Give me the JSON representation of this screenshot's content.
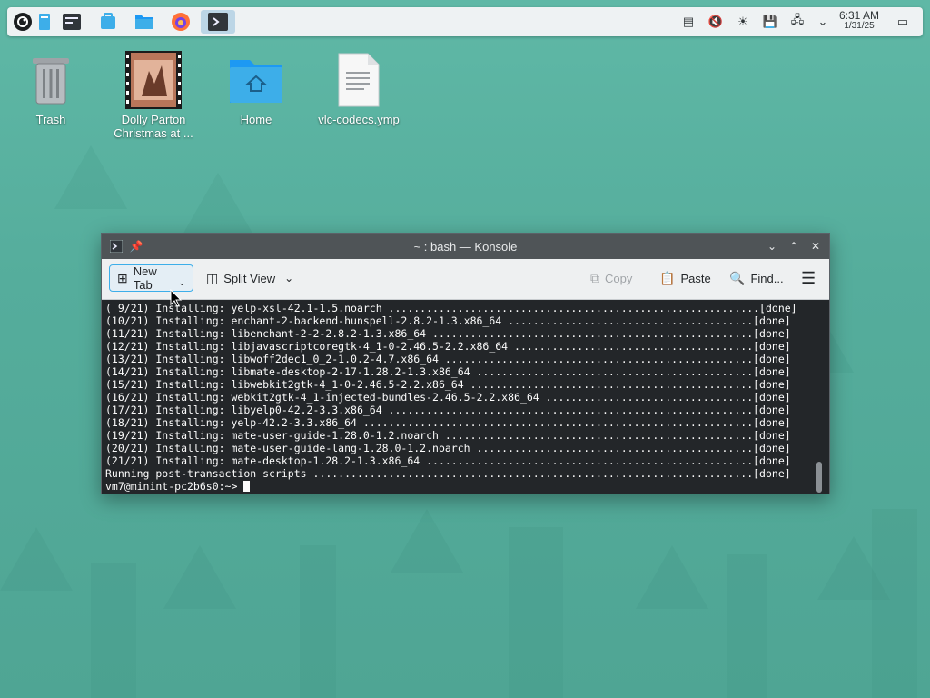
{
  "panel": {
    "clock": {
      "time": "6:31 AM",
      "date": "1/31/25"
    },
    "launchers": [
      "opensuse-menu-icon",
      "task-manager-icon",
      "terminal-icon",
      "discover-icon",
      "file-manager-icon",
      "firefox-icon",
      "konsole-task-icon"
    ],
    "tray": [
      "clipboard-icon",
      "volume-muted-icon",
      "brightness-icon",
      "save-icon",
      "network-icon",
      "expand-tray-icon",
      "show-desktop-icon"
    ]
  },
  "desktop": {
    "icons": [
      {
        "label": "Trash",
        "icon": "trash-icon"
      },
      {
        "label": "Dolly Parton Christmas at ...",
        "icon": "video-thumbnail"
      },
      {
        "label": "Home",
        "icon": "home-folder-icon"
      },
      {
        "label": "vlc-codecs.ymp",
        "icon": "document-icon"
      }
    ]
  },
  "window": {
    "title": "~ : bash — Konsole",
    "toolbar": {
      "new_tab": "New Tab",
      "split_view": "Split View",
      "copy": "Copy",
      "paste": "Paste",
      "find": "Find..."
    },
    "terminal": {
      "lines": [
        "( 9/21) Installing: yelp-xsl-42.1-1.5.noarch ...........................................................[done]",
        "(10/21) Installing: enchant-2-backend-hunspell-2.8.2-1.3.x86_64 .......................................[done]",
        "(11/21) Installing: libenchant-2-2-2.8.2-1.3.x86_64 ...................................................[done]",
        "(12/21) Installing: libjavascriptcoregtk-4_1-0-2.46.5-2.2.x86_64 ......................................[done]",
        "(13/21) Installing: libwoff2dec1_0_2-1.0.2-4.7.x86_64 .................................................[done]",
        "(14/21) Installing: libmate-desktop-2-17-1.28.2-1.3.x86_64 ............................................[done]",
        "(15/21) Installing: libwebkit2gtk-4_1-0-2.46.5-2.2.x86_64 .............................................[done]",
        "(16/21) Installing: webkit2gtk-4_1-injected-bundles-2.46.5-2.2.x86_64 .................................[done]",
        "(17/21) Installing: libyelp0-42.2-3.3.x86_64 ..........................................................[done]",
        "(18/21) Installing: yelp-42.2-3.3.x86_64 ..............................................................[done]",
        "(19/21) Installing: mate-user-guide-1.28.0-1.2.noarch .................................................[done]",
        "(20/21) Installing: mate-user-guide-lang-1.28.0-1.2.noarch ............................................[done]",
        "(21/21) Installing: mate-desktop-1.28.2-1.3.x86_64 ....................................................[done]",
        "Running post-transaction scripts ......................................................................[done]"
      ],
      "prompt": "vm7@minint-pc2b6s0:~> "
    }
  },
  "colors": {
    "accent": "#3daee9",
    "terminal_bg": "#232629",
    "titlebar": "#4f5457"
  }
}
